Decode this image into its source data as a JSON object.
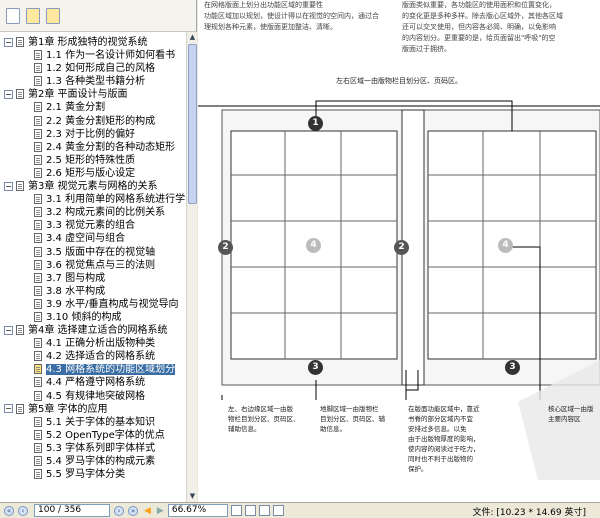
{
  "sidebar": {
    "tree": [
      {
        "kind": "chapter",
        "label": "第1章 形成独特的视觉系统"
      },
      {
        "kind": "section",
        "label": "1.1 作为一名设计师如何看书"
      },
      {
        "kind": "section",
        "label": "1.2 如何形成自己的风格"
      },
      {
        "kind": "section",
        "label": "1.3 各种类型书籍分析"
      },
      {
        "kind": "chapter",
        "label": "第2章 平面设计与版面"
      },
      {
        "kind": "section",
        "label": "2.1 黄金分割"
      },
      {
        "kind": "section",
        "label": "2.2 黄金分割矩形的构成"
      },
      {
        "kind": "section",
        "label": "2.3 对于比例的偏好"
      },
      {
        "kind": "section",
        "label": "2.4 黄金分割的各种动态矩形"
      },
      {
        "kind": "section",
        "label": "2.5 矩形的特殊性质"
      },
      {
        "kind": "section",
        "label": "2.6 矩形与版心设定"
      },
      {
        "kind": "chapter",
        "label": "第3章 视觉元素与网格的关系"
      },
      {
        "kind": "section",
        "label": "3.1 利用简单的网格系统进行学习"
      },
      {
        "kind": "section",
        "label": "3.2 构成元素间的比例关系"
      },
      {
        "kind": "section",
        "label": "3.3 视觉元素的组合"
      },
      {
        "kind": "section",
        "label": "3.4 虚空间与组合"
      },
      {
        "kind": "section",
        "label": "3.5 版面中存在的视觉轴"
      },
      {
        "kind": "section",
        "label": "3.6 视觉焦点与三的法则"
      },
      {
        "kind": "section",
        "label": "3.7 图与构成"
      },
      {
        "kind": "section",
        "label": "3.8 水平构成"
      },
      {
        "kind": "section",
        "label": "3.9 水平/垂直构成与视觉导向"
      },
      {
        "kind": "section",
        "label": "3.10 倾斜的构成"
      },
      {
        "kind": "chapter",
        "label": "第4章 选择建立适合的网格系统"
      },
      {
        "kind": "section",
        "label": "4.1 正确分析出版物种类"
      },
      {
        "kind": "section",
        "label": "4.2 选择适合的网格系统"
      },
      {
        "kind": "section",
        "label": "4.3 网格系统的功能区域划分",
        "selected": true
      },
      {
        "kind": "section",
        "label": "4.4 严格遵守网格系统"
      },
      {
        "kind": "section",
        "label": "4.5 有规律地突破网格"
      },
      {
        "kind": "chapter",
        "label": "第5章 字体的应用"
      },
      {
        "kind": "section",
        "label": "5.1 关于字体的基本知识"
      },
      {
        "kind": "section",
        "label": "5.2 OpenType字体的优点"
      },
      {
        "kind": "section",
        "label": "5.3 字体系列即字体样式"
      },
      {
        "kind": "section",
        "label": "5.4 罗马字体的构成元素"
      },
      {
        "kind": "section",
        "label": "5.5 罗马字体分类"
      }
    ]
  },
  "page": {
    "text_left": [
      "在网格版面上划分出功能区域的重要性",
      "功能区域加以规划，使设计得以在视觉的空间内，通过合",
      "理规划各种元素，使版面更加整洁、清晰。"
    ],
    "text_right": [
      "版面类似重要，各功能区的使用面积和位置变化，",
      "的变化更是多种多样。除去版心区域外，其他各区域",
      "还可以交叉使用，但内容各必简、明确，以免影响",
      "的内容划分。更重要的是，给页面留出\"呼吸\"的空",
      "版面过于拥挤。"
    ],
    "caption": "左右区域一由版物栏目划分区、页码区。",
    "markers": [
      "1",
      "2",
      "4",
      "2",
      "3",
      "3",
      "4"
    ],
    "notes": [
      [
        "左、右边缘区域一由版",
        "物栏目划分区、页码区、",
        "辅助信息。"
      ],
      [
        "地脚区域一由版物栏",
        "目划分区、页码区、辅",
        "助信息。"
      ],
      [
        "在版面功能区域中，靠近",
        "书脊的部分区域内不宜",
        "安排过多信息。以免",
        "由于出版物厚度的影响，",
        "使内容的阅读过于吃力，",
        "同时也不利于出版物的",
        "保护。"
      ],
      [
        "核心区域一由版",
        "主要内容区"
      ]
    ]
  },
  "bottom": {
    "page_number": "100 / 356",
    "zoom": "66.67%",
    "file_size": "文件: [10.23 * 14.69 英寸]"
  },
  "colors": {
    "accent": "#3a6ea5",
    "sidebar_bg": "#ffffff",
    "chrome_bg": "#ece9d8"
  }
}
